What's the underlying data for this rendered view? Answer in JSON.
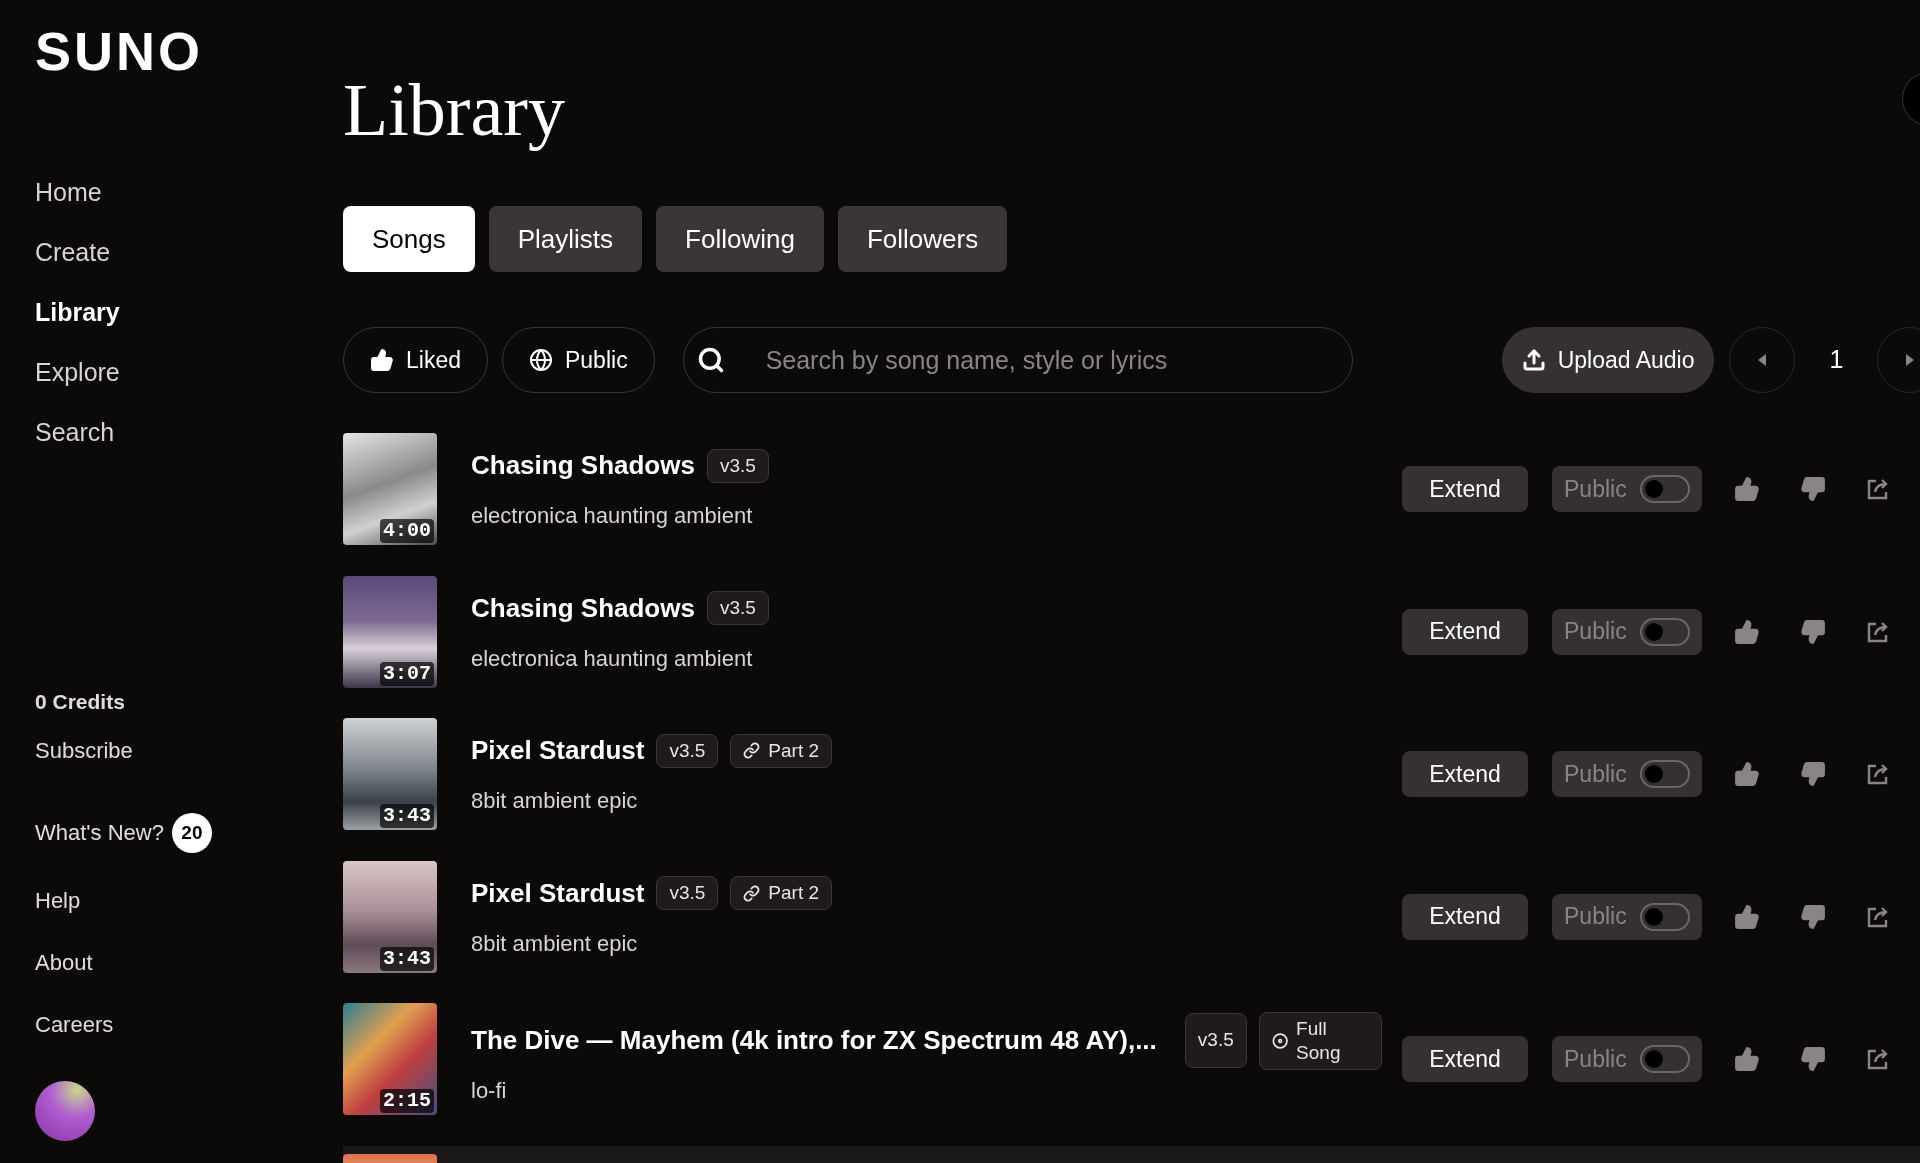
{
  "sidebar": {
    "logo": "SUNO",
    "nav": [
      {
        "label": "Home",
        "selected": false
      },
      {
        "label": "Create",
        "selected": false
      },
      {
        "label": "Library",
        "selected": true
      },
      {
        "label": "Explore",
        "selected": false
      },
      {
        "label": "Search",
        "selected": false
      }
    ],
    "credits": "0 Credits",
    "links": [
      {
        "label": "Subscribe"
      },
      {
        "label": "What's New?",
        "badge": "20"
      },
      {
        "label": "Help"
      },
      {
        "label": "About"
      },
      {
        "label": "Careers"
      }
    ]
  },
  "page": {
    "title": "Library"
  },
  "tabs": [
    {
      "label": "Songs",
      "selected": true
    },
    {
      "label": "Playlists",
      "selected": false
    },
    {
      "label": "Following",
      "selected": false
    },
    {
      "label": "Followers",
      "selected": false
    }
  ],
  "filters": [
    {
      "label": "Liked",
      "kind": "like"
    },
    {
      "label": "Public",
      "kind": "globe"
    }
  ],
  "search": {
    "placeholder": "Search by song name, style or lyrics"
  },
  "upload_button": "Upload Audio",
  "pagination": {
    "page": "1"
  },
  "songs": [
    {
      "title": "Chasing Shadows",
      "version": "v3.5",
      "style": "electronica haunting ambient",
      "duration": "4:00",
      "extend": "Extend",
      "public_label": "Public",
      "public": false
    },
    {
      "title": "Chasing Shadows",
      "version": "v3.5",
      "style": "electronica haunting ambient",
      "duration": "3:07",
      "extend": "Extend",
      "public_label": "Public",
      "public": false
    },
    {
      "title": "Pixel Stardust",
      "version": "v3.5",
      "tag": {
        "label": "Part 2",
        "kind": "link"
      },
      "style": "8bit ambient epic",
      "duration": "3:43",
      "extend": "Extend",
      "public_label": "Public",
      "public": false
    },
    {
      "title": "Pixel Stardust",
      "version": "v3.5",
      "tag": {
        "label": "Part 2",
        "kind": "link"
      },
      "style": "8bit ambient epic",
      "duration": "3:43",
      "extend": "Extend",
      "public_label": "Public",
      "public": false
    },
    {
      "title": "The Dive — Mayhem (4k intro for ZX Spectrum 48 AY),...",
      "version": "v3.5",
      "tag": {
        "label": "Full Song",
        "kind": "disc"
      },
      "style": "lo-fi",
      "duration": "2:15",
      "extend": "Extend",
      "public_label": "Public",
      "public": false
    }
  ]
}
